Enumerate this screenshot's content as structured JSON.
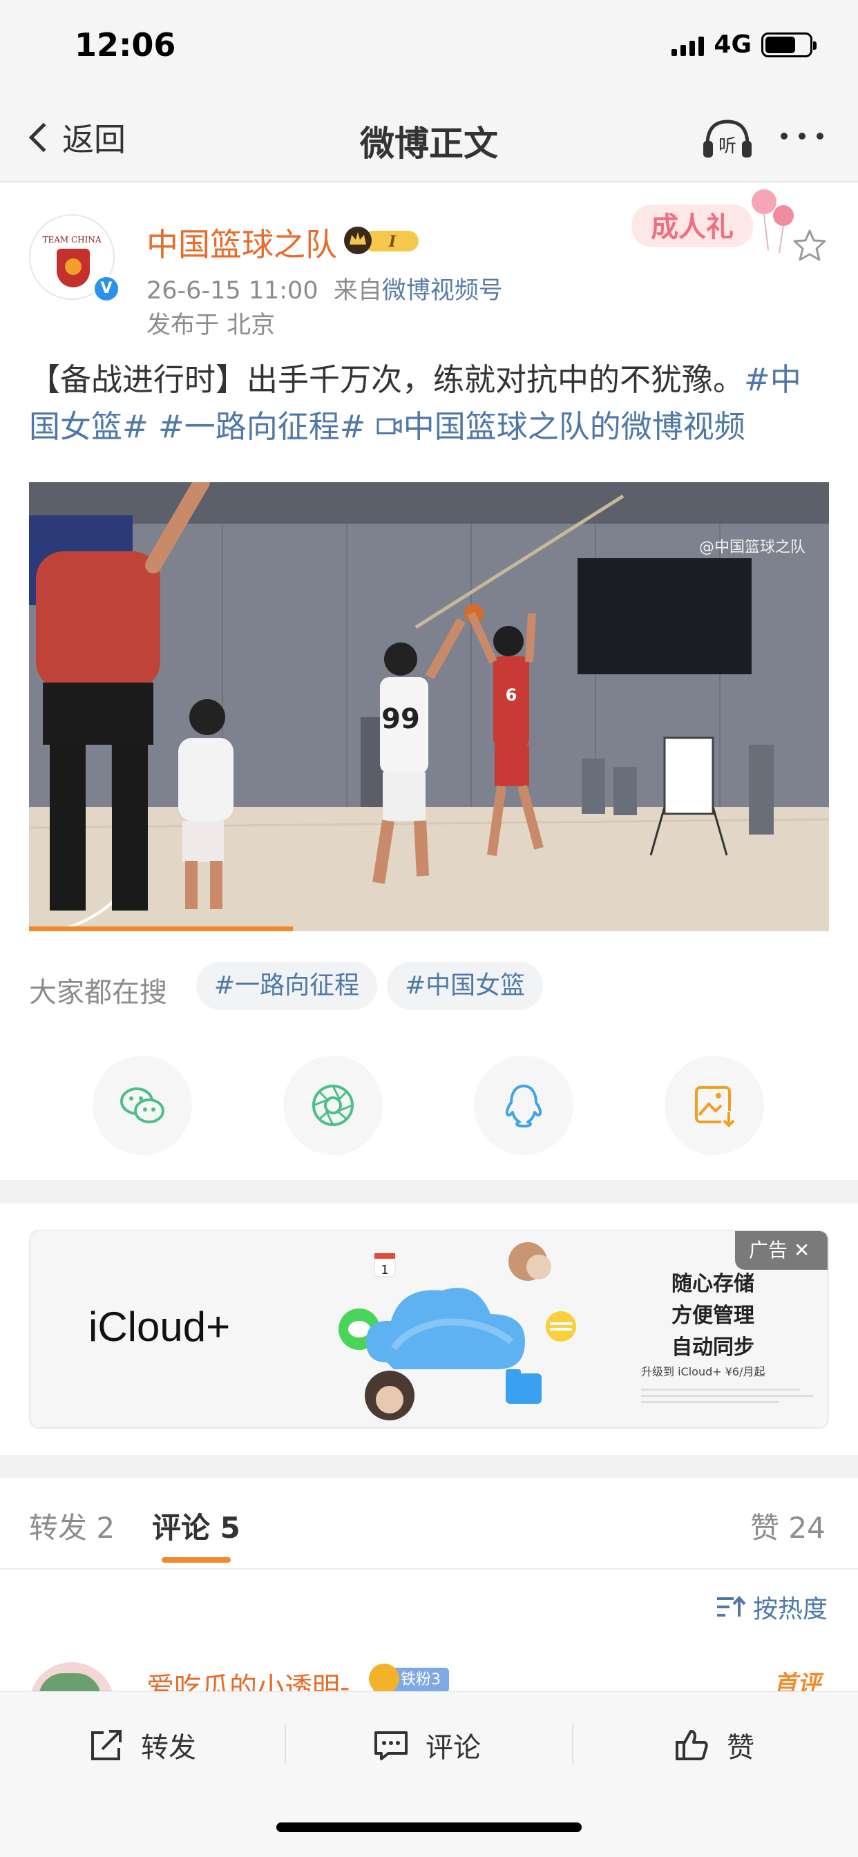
{
  "status_bar": {
    "time": "12:06",
    "network": "4G"
  },
  "nav": {
    "back_label": "返回",
    "title": "微博正文",
    "listen_label": "听"
  },
  "post": {
    "author": "中国篮球之队",
    "member_badge": "I",
    "time": "26-6-15 11:00",
    "source_prefix": "来自",
    "source": "微博视频号",
    "location": "发布于 北京",
    "sticker_text": "成人礼",
    "avatar_text": "TEAM CHINA",
    "text_plain": "【备战进行时】出手千万次，练就对抗中的不犹豫。",
    "tag_1": "#中国女篮#",
    "tag_2": "#一路向征程#",
    "video_link": "中国篮球之队的微博视频",
    "video_link_icon": "video-link-icon",
    "image_watermark": "@中国篮球之队",
    "video_progress": 0.33
  },
  "hot_search": {
    "label": "大家都在搜",
    "chips": [
      "#一路向征程",
      "#中国女篮"
    ]
  },
  "share": {
    "icons": [
      "wechat-icon",
      "moments-icon",
      "qq-icon",
      "save-image-icon"
    ]
  },
  "ad": {
    "brand": "iCloud+",
    "tag": "广告",
    "copy_1": "随心存储",
    "copy_2": "方便管理",
    "copy_3": "自动同步",
    "small": "升级到 iCloud+ ¥6/月起"
  },
  "tabs": {
    "repost": "转发 2",
    "comment": "评论 5",
    "like": "赞 24",
    "active": "comment"
  },
  "sort_label": "按热度",
  "comment_preview": {
    "name": "爱吃瓜的小透明-",
    "fan_badge": "铁粉3",
    "first_tag": "首评"
  },
  "bottom_bar": {
    "repost": "转发",
    "comment": "评论",
    "like": "赞"
  },
  "colors": {
    "accent_orange": "#f08a2a",
    "username_orange": "#e86b2a",
    "link_blue": "#4f78a8",
    "verified_blue": "#2c91e8"
  }
}
